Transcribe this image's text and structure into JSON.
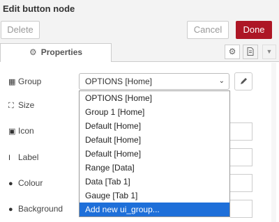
{
  "header": {
    "title": "Edit button node"
  },
  "toolbar": {
    "delete_label": "Delete",
    "cancel_label": "Cancel",
    "done_label": "Done"
  },
  "tabs": {
    "properties_label": "Properties"
  },
  "form": {
    "group_label": "Group",
    "size_label": "Size",
    "icon_label": "Icon",
    "label_label": "Label",
    "colour_label": "Colour",
    "background_label": "Background",
    "group_value": "OPTIONS [Home]"
  },
  "dropdown": {
    "options": [
      "OPTIONS [Home]",
      "Group 1 [Home]",
      "Default [Home]",
      "Default [Home]",
      "Default [Home]",
      "Range [Data]",
      "Data [Tab 1]",
      "Gauge [Tab 1]",
      "Add new ui_group..."
    ],
    "highlighted": "Add new ui_group..."
  },
  "icons": [
    "gear-icon",
    "document-icon",
    "caret-down-icon",
    "pencil-icon",
    "table-icon",
    "resize-icon",
    "image-icon",
    "text-cursor-icon",
    "drop-icon"
  ],
  "colors": {
    "done": "#ad1625",
    "highlight": "#1e6fd9"
  }
}
